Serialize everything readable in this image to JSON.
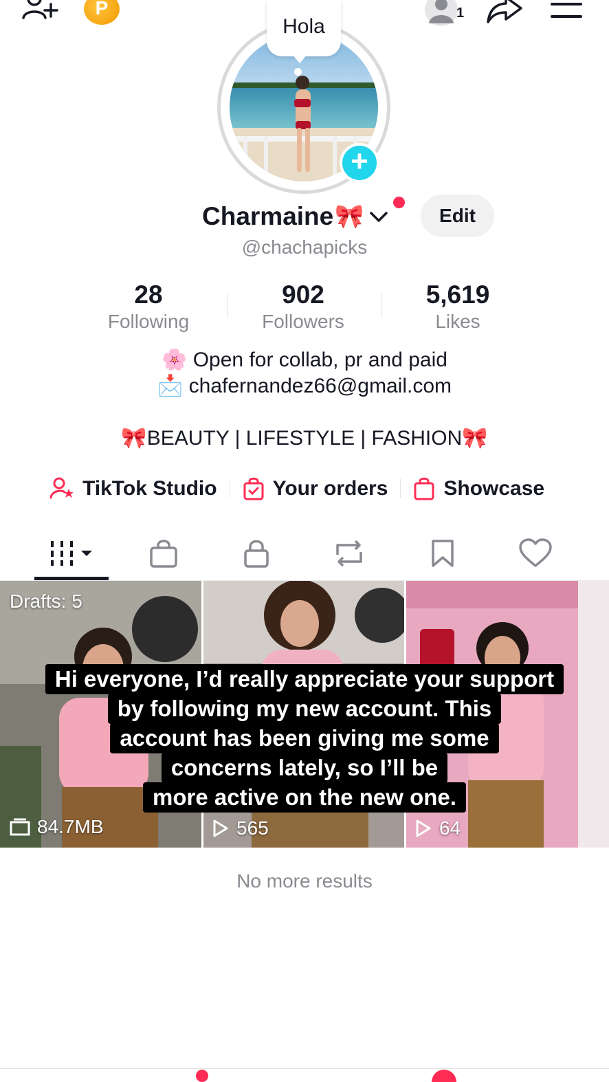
{
  "header": {
    "coin_letter": "P",
    "account_count": "1",
    "icons": [
      "add-friend-icon",
      "coin-icon",
      "account-switch-icon",
      "share-icon",
      "menu-icon"
    ]
  },
  "avatar": {
    "bubble_text": "Hola"
  },
  "profile": {
    "display_name": "Charmaine",
    "name_emoji": "🎀",
    "edit_label": "Edit",
    "username": "@chachapicks"
  },
  "stats": [
    {
      "value": "28",
      "label": "Following"
    },
    {
      "value": "902",
      "label": "Followers"
    },
    {
      "value": "5,619",
      "label": "Likes"
    }
  ],
  "bio": {
    "line1": "🌸 Open for collab, pr and paid",
    "line2": "📩 chafernandez66@gmail.com",
    "line3": "🎀BEAUTY | LIFESTYLE | FASHION🎀"
  },
  "links": [
    {
      "label": "TikTok Studio",
      "icon": "studio-icon"
    },
    {
      "label": "Your orders",
      "icon": "orders-bag-icon"
    },
    {
      "label": "Showcase",
      "icon": "showcase-bag-icon"
    }
  ],
  "tabs": [
    "videos-grid",
    "shop",
    "private",
    "reposts",
    "saved",
    "liked"
  ],
  "grid": {
    "tiles": [
      {
        "top_label": "Drafts: 5",
        "bottom_label": "84.7MB",
        "bottom_icon": "drafts-icon"
      },
      {
        "bottom_label": "565",
        "bottom_icon": "play-icon"
      },
      {
        "bottom_label": "64",
        "bottom_icon": "play-icon"
      }
    ]
  },
  "caption": {
    "lines": [
      "Hi everyone, I’d really appreciate your support",
      "by following my new account. This",
      "account has been giving me some",
      "concerns lately, so I’ll be",
      "more active on the new one."
    ]
  },
  "footer": {
    "no_more_results": "No more results"
  },
  "colors": {
    "accent": "#fe2c55",
    "avatar_plus": "#20d5ec",
    "text_primary": "#161823",
    "text_secondary": "#8a8b91"
  }
}
